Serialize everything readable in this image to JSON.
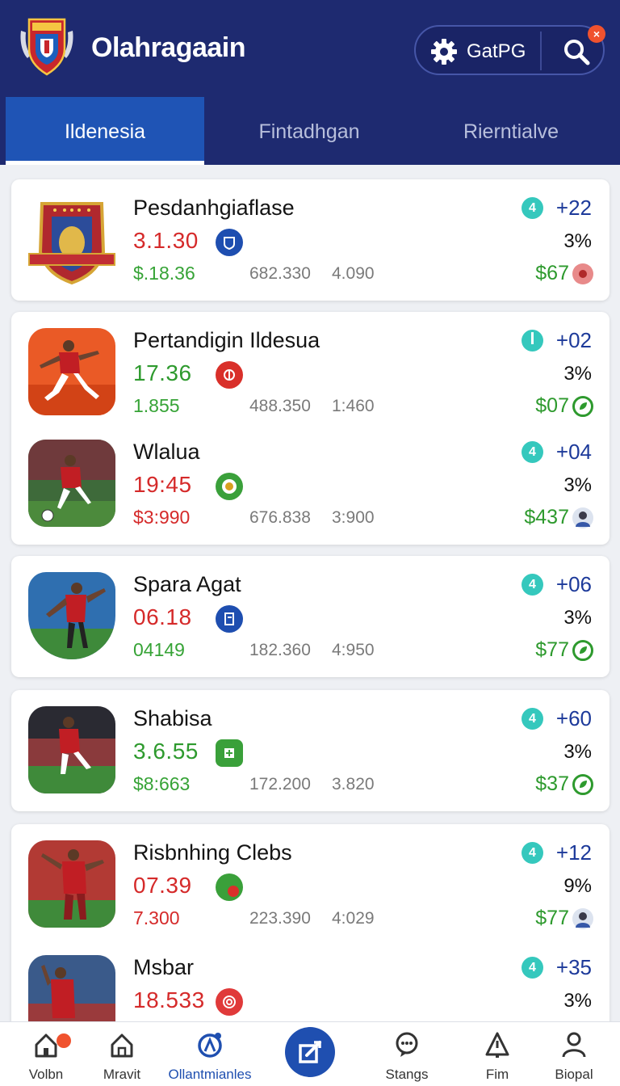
{
  "header": {
    "title": "Olahragaain",
    "action_label": "GatPG",
    "notif_count": "×"
  },
  "tabs": [
    {
      "label": "Ildenesia",
      "active": true
    },
    {
      "label": "Fintadhgan",
      "active": false
    },
    {
      "label": "Rierntialve",
      "active": false
    }
  ],
  "matches": [
    {
      "name": "Pesdanhgiaflase",
      "score": "3.1.30",
      "score_color": "red",
      "sub": "$.18.36",
      "sub_color": "green",
      "stat1": "682.330",
      "stat2": "4.090",
      "rank": "4",
      "delta": "+22",
      "pct": "3%",
      "money": "$67",
      "badge_icon": "shield-badge-icon",
      "end_icon": "red-coin-icon"
    },
    {
      "name": "Pertandigin Ildesua",
      "score": "17.36",
      "score_color": "green",
      "sub": "1.855",
      "sub_color": "green",
      "stat1": "488.350",
      "stat2": "1:460",
      "rank": "ꟾ",
      "delta": "+02",
      "pct": "3%",
      "money": "$07",
      "badge_icon": "red-crest-badge-icon",
      "end_icon": "green-leaf-icon"
    },
    {
      "name": "Wlalua",
      "score": "19:45",
      "score_color": "red",
      "sub": "$3:990",
      "sub_color": "red",
      "stat1": "676.838",
      "stat2": "3:900",
      "rank": "4",
      "delta": "+04",
      "pct": "3%",
      "money": "$437",
      "badge_icon": "green-ring-badge-icon",
      "end_icon": "avatar-icon"
    },
    {
      "name": "Spara Agat",
      "score": "06.18",
      "score_color": "red",
      "sub": "04149",
      "sub_color": "green",
      "stat1": "182.360",
      "stat2": "4:950",
      "rank": "4",
      "delta": "+06",
      "pct": "3%",
      "money": "$77",
      "badge_icon": "blue-doc-badge-icon",
      "end_icon": "green-leaf-icon"
    },
    {
      "name": "Shabisa",
      "score": "3.6.55",
      "score_color": "green",
      "sub": "$8:663",
      "sub_color": "green",
      "stat1": "172.200",
      "stat2": "3.820",
      "rank": "4",
      "delta": "+60",
      "pct": "3%",
      "money": "$37",
      "badge_icon": "green-square-badge-icon",
      "end_icon": "green-leaf-icon"
    },
    {
      "name": "Risbnhing Clebs",
      "score": "07.39",
      "score_color": "red",
      "sub": "7.300",
      "sub_color": "red",
      "stat1": "223.390",
      "stat2": "4:029",
      "rank": "4",
      "delta": "+12",
      "pct": "9%",
      "money": "$77",
      "badge_icon": "green-red-badge-icon",
      "end_icon": "avatar-icon"
    },
    {
      "name": "Msbar",
      "score": "18.533",
      "score_color": "red",
      "sub": "",
      "sub_color": "red",
      "stat1": "",
      "stat2": "",
      "rank": "4",
      "delta": "+35",
      "pct": "3%",
      "money": "",
      "badge_icon": "red-swirl-badge-icon",
      "end_icon": ""
    }
  ],
  "nav": [
    {
      "label": "Volbn",
      "icon": "home-icon"
    },
    {
      "label": "Mravit",
      "icon": "house-icon"
    },
    {
      "label": "Ollantmianles",
      "icon": "ball-icon",
      "active": true
    },
    {
      "label": "",
      "icon": "compose-icon"
    },
    {
      "label": "Stangs",
      "icon": "chat-icon"
    },
    {
      "label": "Fim",
      "icon": "alert-icon"
    },
    {
      "label": "Biopal",
      "icon": "user-icon"
    }
  ]
}
